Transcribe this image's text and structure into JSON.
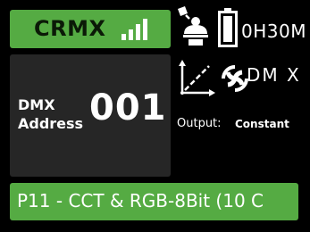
{
  "header": {
    "connection_label": "CRMX",
    "signal_icon": "signal-bars-icon",
    "mode_icon": "light-fixture-mode-icon",
    "battery_icon": "battery-icon",
    "runtime": "0H30M"
  },
  "dmx": {
    "label_line1": "DMX",
    "label_line2": "Address",
    "address": "001"
  },
  "status": {
    "curve_icon": "dimming-curve-icon",
    "protocol_logo": "dmx-logo-icon",
    "protocol_text": "DM X",
    "output_label": "Output:",
    "output_value": "Constant"
  },
  "profile": {
    "text": "P11 - CCT & RGB-8Bit (10 C"
  },
  "colors": {
    "accent_green": "#55ab43",
    "panel_dark": "#262626",
    "background": "#000000",
    "text": "#ffffff"
  }
}
